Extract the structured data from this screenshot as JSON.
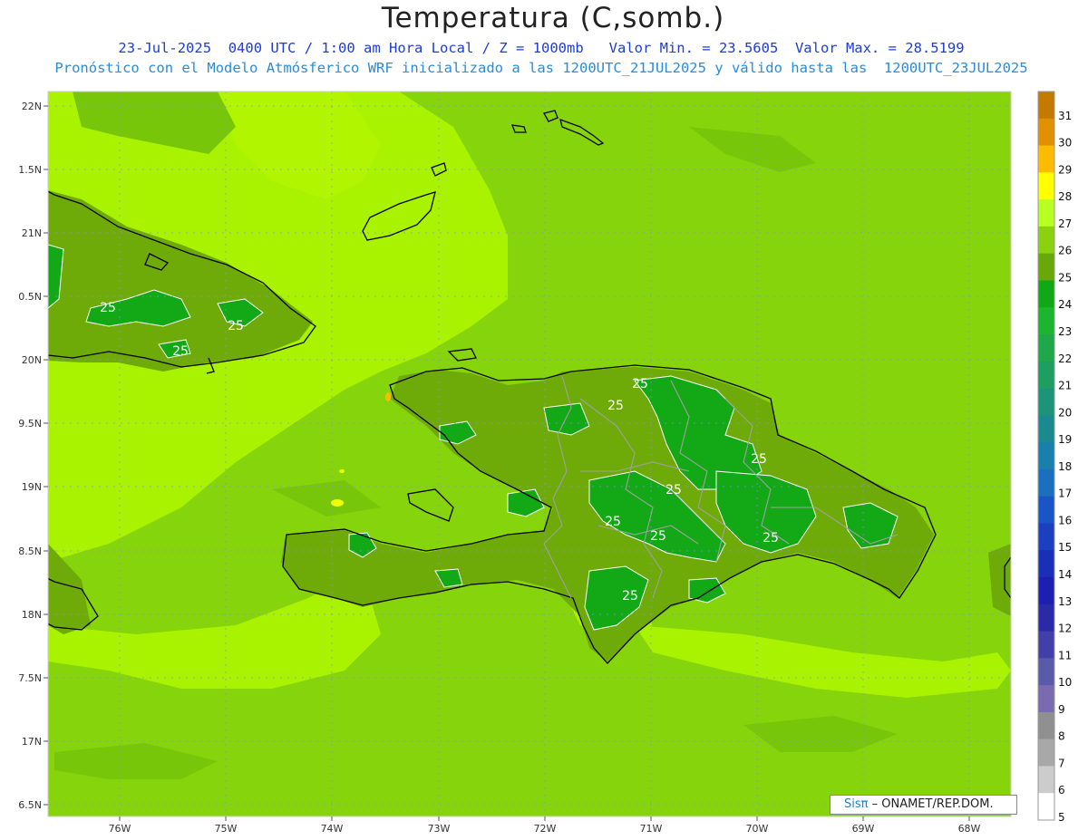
{
  "header": {
    "title": "Temperatura (C,somb.)",
    "line1": "23-Jul-2025  0400 UTC / 1:00 am Hora Local / Z = 1000mb   Valor Min. = 23.5605  Valor Max. = 28.5199",
    "line2": "Pronóstico con el Modelo Atmósferico WRF inicializado a las 1200UTC_21JUL2025 y válido hasta las  1200UTC_23JUL2025"
  },
  "axes": {
    "lat_labels": [
      "22N",
      "1.5N",
      "21N",
      "0.5N",
      "20N",
      "9.5N",
      "19N",
      "8.5N",
      "18N",
      "7.5N",
      "17N",
      "6.5N"
    ],
    "lon_labels": [
      "76W",
      "75W",
      "74W",
      "73W",
      "72W",
      "71W",
      "70W",
      "69W",
      "68W"
    ]
  },
  "colorbar": {
    "labels": [
      "31",
      "30",
      "29",
      "28",
      "27",
      "26",
      "25",
      "24",
      "23",
      "22",
      "21",
      "20",
      "19",
      "18",
      "17",
      "16",
      "15",
      "14",
      "13",
      "12",
      "11",
      "10",
      "9",
      "8",
      "7",
      "6",
      "5"
    ],
    "colors": [
      "#c47a00",
      "#e09000",
      "#ffbb00",
      "#ffff00",
      "#b8ff22",
      "#8ad10e",
      "#6aa80a",
      "#10a816",
      "#1bb530",
      "#1fa84a",
      "#1f9e62",
      "#1c9478",
      "#1a8a90",
      "#1880aa",
      "#1a6fc0",
      "#1a55c8",
      "#1a40c0",
      "#1a2fb8",
      "#1c1fb0",
      "#2a2aa8",
      "#4040a8",
      "#5a5aaa",
      "#7a6ab0",
      "#909090",
      "#a8a8a8",
      "#cccccc",
      "#ffffff"
    ]
  },
  "contour_labels": [
    "25",
    "25",
    "25",
    "25",
    "25",
    "25",
    "25",
    "25",
    "25",
    "25",
    "25"
  ],
  "colors": {
    "sea_base": "#a8f500",
    "land_mid": "#72b80a",
    "land_high": "#18a818",
    "coast": "#000000",
    "borders": "#999999"
  },
  "credit": {
    "brand": "Sisπ",
    "text": " – ONAMET/REP.DOM."
  }
}
